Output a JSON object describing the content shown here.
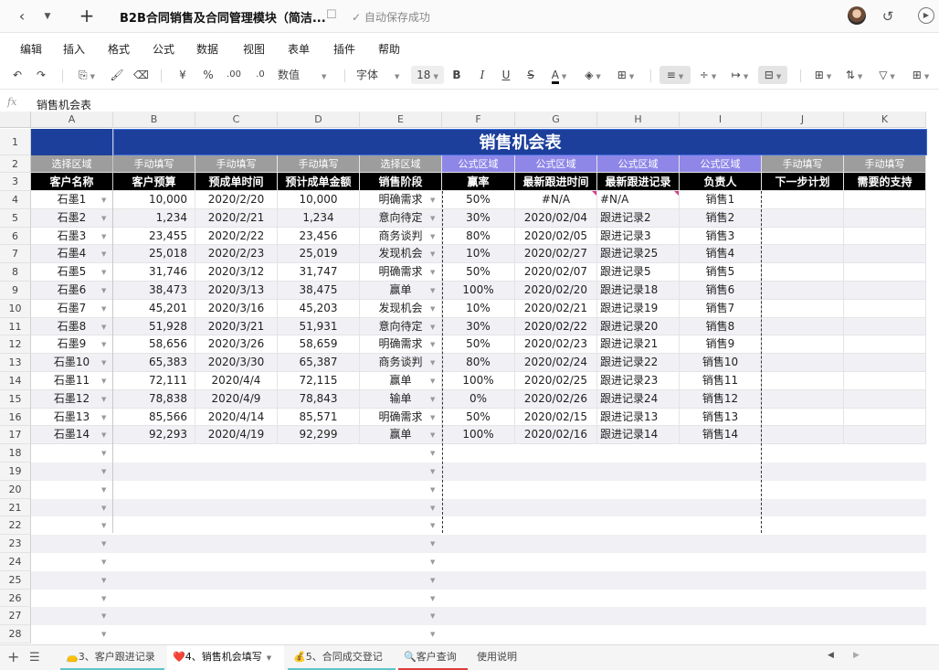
{
  "titlebar": {
    "title": "B2B合同销售及合同管理模块（简洁...",
    "save_status": "自动保存成功"
  },
  "menu": [
    "编辑",
    "插入",
    "格式",
    "公式",
    "数据",
    "视图",
    "表单",
    "插件",
    "帮助"
  ],
  "toolbar": {
    "currency": "¥",
    "percent": "%",
    "decimal_add": ".00",
    "decimal_remove": ".0",
    "number_format": "数值",
    "font_family": "字体",
    "font_size": "18",
    "bold": "B",
    "italic": "I",
    "underline": "U",
    "strike": "S",
    "font_color": "A"
  },
  "formula_bar": {
    "fx": "fx",
    "content": "销售机会表"
  },
  "columns": [
    "A",
    "B",
    "C",
    "D",
    "E",
    "F",
    "G",
    "H",
    "I",
    "J",
    "K"
  ],
  "sheet": {
    "title": "销售机会表",
    "type_row": [
      "选择区域",
      "手动填写",
      "手动填写",
      "手动填写",
      "选择区域",
      "公式区域",
      "公式区域",
      "公式区域",
      "公式区域",
      "手动填写",
      "手动填写"
    ],
    "header_row": [
      "客户名称",
      "客户预算",
      "预成单时间",
      "预计成单金额",
      "销售阶段",
      "赢率",
      "最新跟进时间",
      "最新跟进记录",
      "负责人",
      "下一步计划",
      "需要的支持"
    ],
    "rows": [
      [
        "石墨1",
        "10,000",
        "2020/2/20",
        "10,000",
        "明确需求",
        "50%",
        "#N/A",
        "#N/A",
        "销售1"
      ],
      [
        "石墨2",
        "1,234",
        "2020/2/21",
        "1,234",
        "意向待定",
        "30%",
        "2020/02/04",
        "跟进记录2",
        "销售2"
      ],
      [
        "石墨3",
        "23,455",
        "2020/2/22",
        "23,456",
        "商务谈判",
        "80%",
        "2020/02/05",
        "跟进记录3",
        "销售3"
      ],
      [
        "石墨4",
        "25,018",
        "2020/2/23",
        "25,019",
        "发现机会",
        "10%",
        "2020/02/27",
        "跟进记录25",
        "销售4"
      ],
      [
        "石墨5",
        "31,746",
        "2020/3/12",
        "31,747",
        "明确需求",
        "50%",
        "2020/02/07",
        "跟进记录5",
        "销售5"
      ],
      [
        "石墨6",
        "38,473",
        "2020/3/13",
        "38,475",
        "赢单",
        "100%",
        "2020/02/20",
        "跟进记录18",
        "销售6"
      ],
      [
        "石墨7",
        "45,201",
        "2020/3/16",
        "45,203",
        "发现机会",
        "10%",
        "2020/02/21",
        "跟进记录19",
        "销售7"
      ],
      [
        "石墨8",
        "51,928",
        "2020/3/21",
        "51,931",
        "意向待定",
        "30%",
        "2020/02/22",
        "跟进记录20",
        "销售8"
      ],
      [
        "石墨9",
        "58,656",
        "2020/3/26",
        "58,659",
        "明确需求",
        "50%",
        "2020/02/23",
        "跟进记录21",
        "销售9"
      ],
      [
        "石墨10",
        "65,383",
        "2020/3/30",
        "65,387",
        "商务谈判",
        "80%",
        "2020/02/24",
        "跟进记录22",
        "销售10"
      ],
      [
        "石墨11",
        "72,111",
        "2020/4/4",
        "72,115",
        "赢单",
        "100%",
        "2020/02/25",
        "跟进记录23",
        "销售11"
      ],
      [
        "石墨12",
        "78,838",
        "2020/4/9",
        "78,843",
        "输单",
        "0%",
        "2020/02/26",
        "跟进记录24",
        "销售12"
      ],
      [
        "石墨13",
        "85,566",
        "2020/4/14",
        "85,571",
        "明确需求",
        "50%",
        "2020/02/15",
        "跟进记录13",
        "销售13"
      ],
      [
        "石墨14",
        "92,293",
        "2020/4/19",
        "92,299",
        "赢单",
        "100%",
        "2020/02/16",
        "跟进记录14",
        "销售14"
      ]
    ],
    "row_numbers": [
      "1",
      "2",
      "3",
      "4",
      "5",
      "6",
      "7",
      "8",
      "9",
      "10",
      "11",
      "12",
      "13",
      "14",
      "15",
      "16",
      "17",
      "18",
      "19",
      "20",
      "21",
      "22",
      "23",
      "24",
      "25",
      "26",
      "27",
      "28"
    ]
  },
  "tabs": [
    {
      "label": "👝3、客户跟进记录",
      "accent": "#5fc4c9"
    },
    {
      "label": "❤️4、销售机会填写",
      "accent": ""
    },
    {
      "label": "💰5、合同成交登记",
      "accent": "#5fc4c9"
    },
    {
      "label": "🔍客户查询",
      "accent": "#e03b3b"
    },
    {
      "label": "使用说明",
      "accent": ""
    }
  ],
  "colors": {
    "title_band": "#1c3f9b",
    "type_row_gray": "#9d9d9d",
    "type_row_formula": "#8f87e8",
    "header_row": "#000000"
  }
}
